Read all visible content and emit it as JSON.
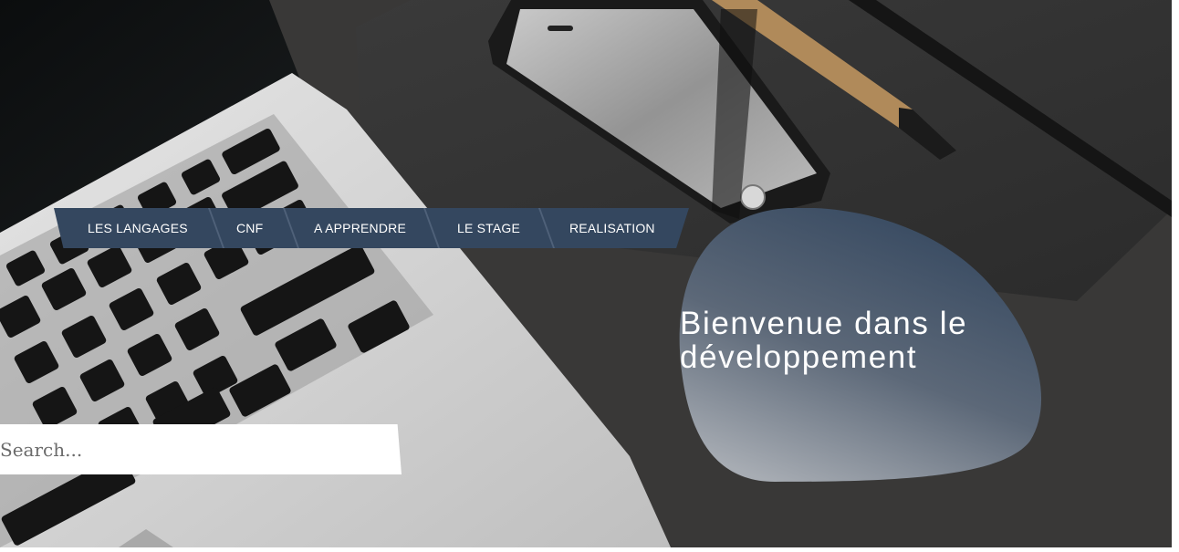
{
  "nav": {
    "items": [
      {
        "label": "LES LANGAGES"
      },
      {
        "label": "CNF"
      },
      {
        "label": "A APPRENDRE"
      },
      {
        "label": "LE STAGE"
      },
      {
        "label": "REALISATION"
      }
    ]
  },
  "hero": {
    "welcome_title": "Bienvenue dans le développement"
  },
  "search": {
    "placeholder": "Search..."
  },
  "colors": {
    "nav_background": "#34475f",
    "blob_top": "#34475f",
    "blob_bottom": "#a7acb3",
    "text": "#ffffff"
  }
}
